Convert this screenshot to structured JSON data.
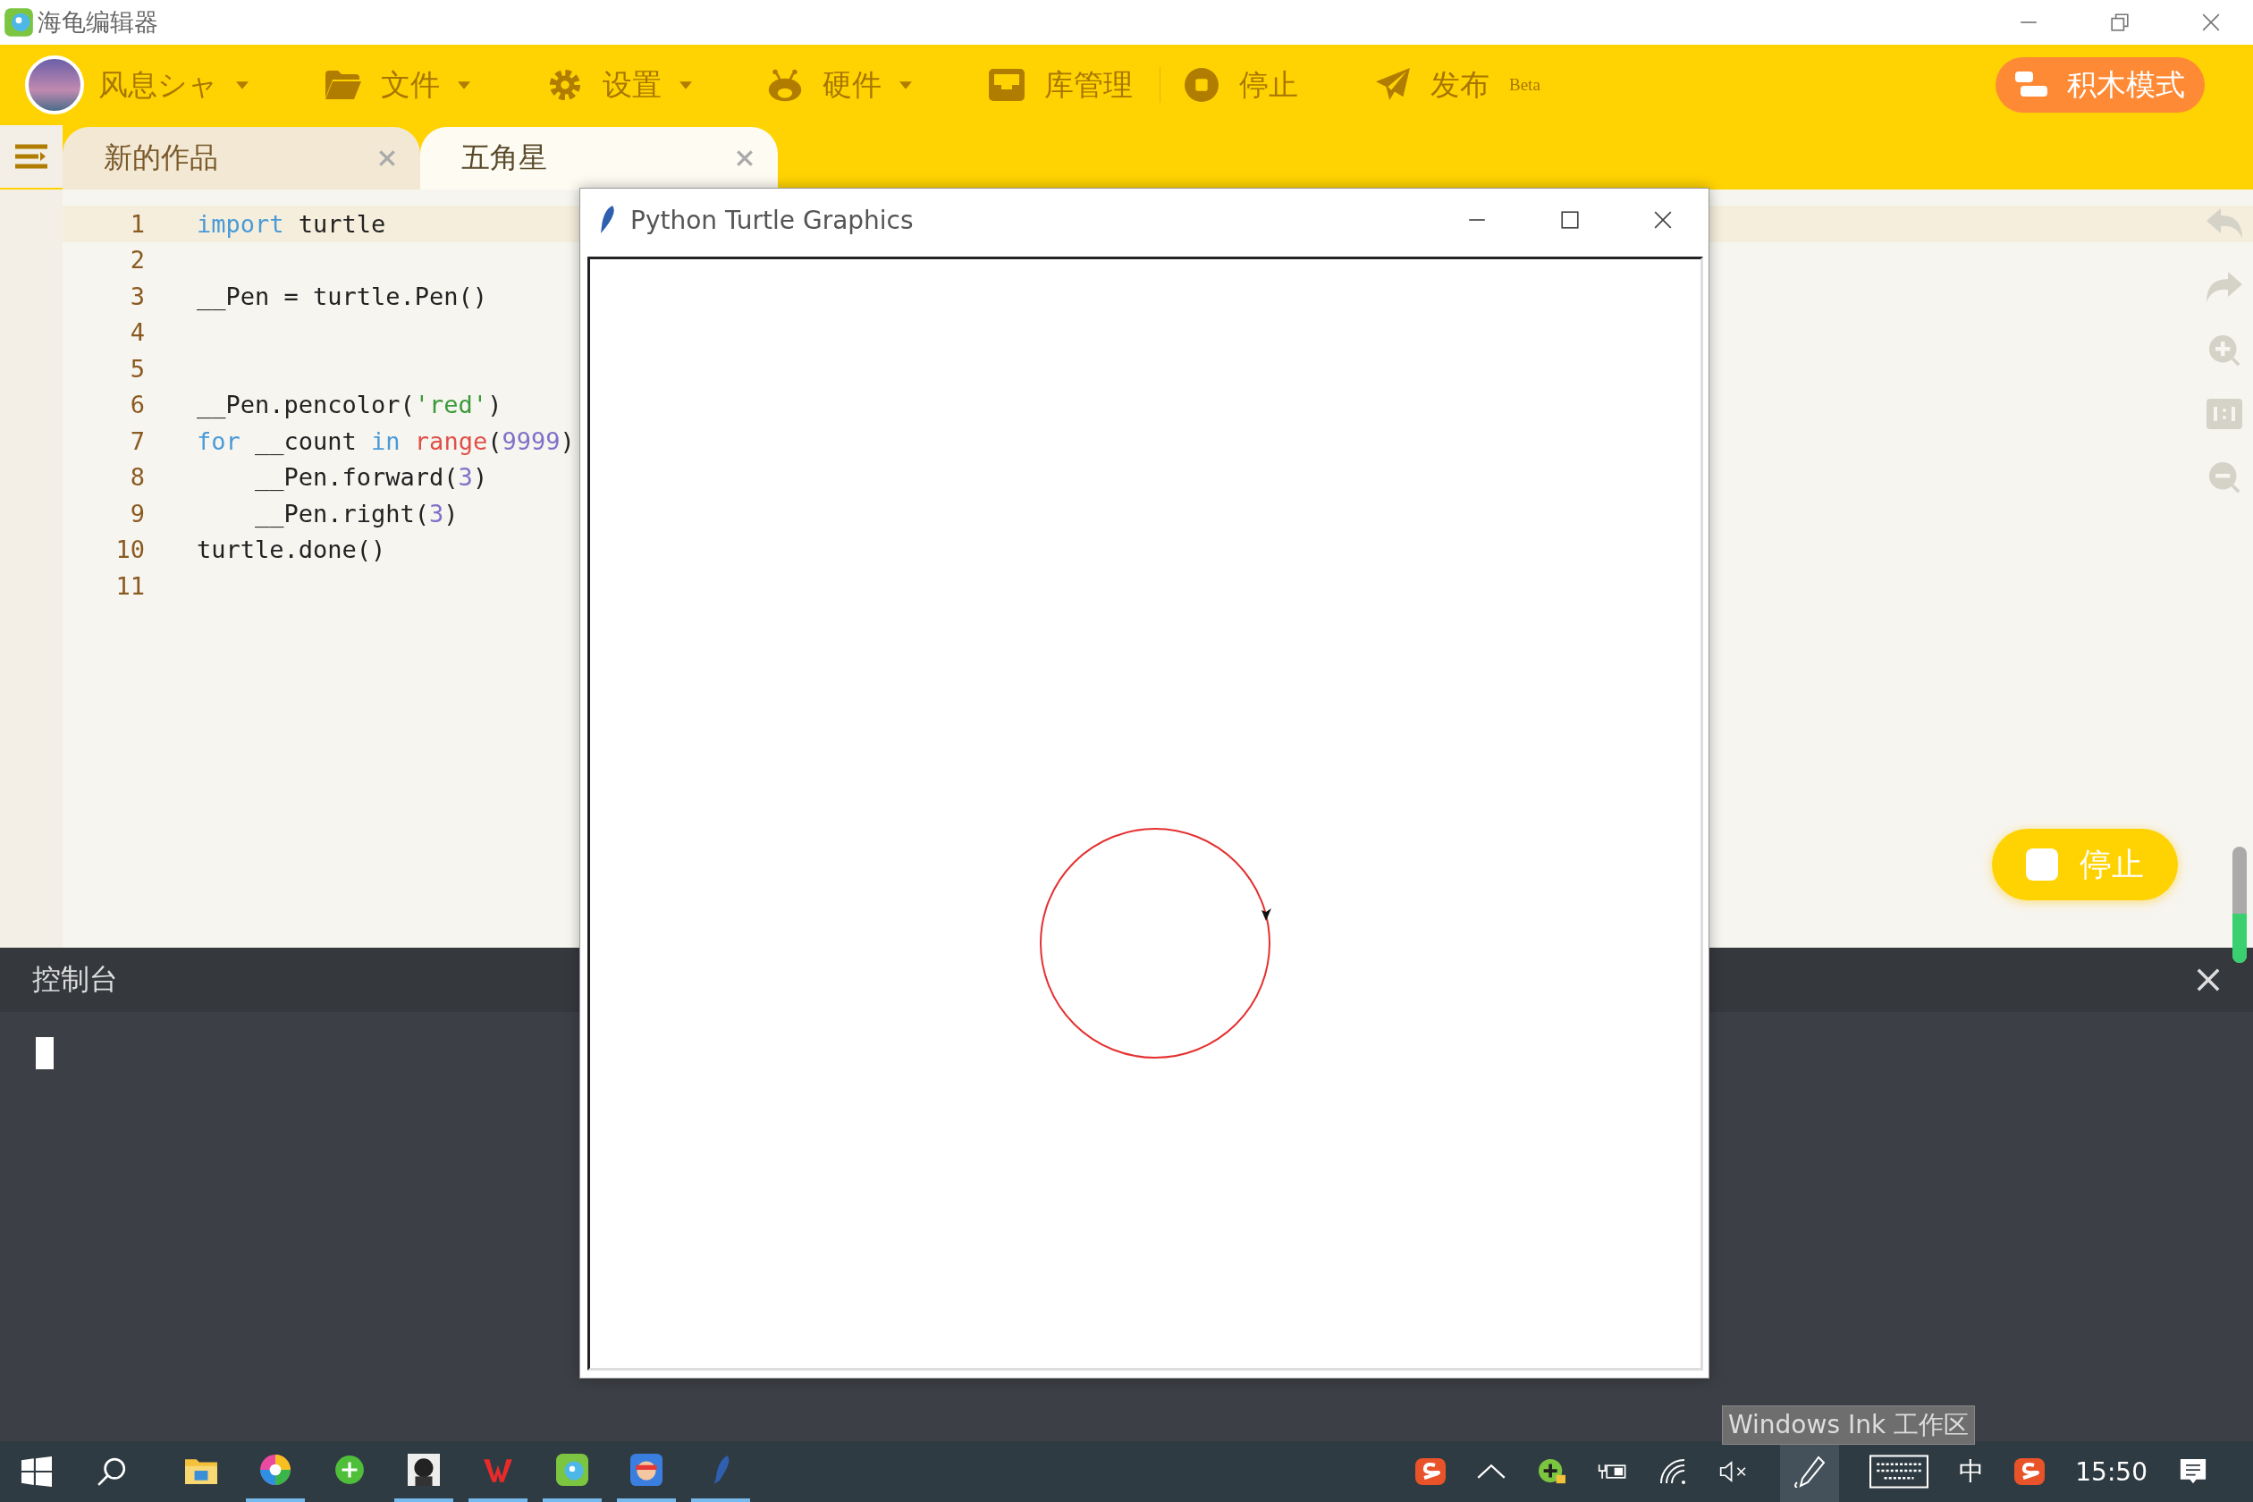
{
  "window": {
    "title": "海龟编辑器"
  },
  "toolbar": {
    "user": "风息シャ",
    "menus": [
      {
        "label": "文件",
        "kind": "folder"
      },
      {
        "label": "设置",
        "kind": "gear"
      },
      {
        "label": "硬件",
        "kind": "robot"
      }
    ],
    "buttons": [
      {
        "label": "库管理",
        "kind": "library"
      },
      {
        "label": "停止",
        "kind": "stop"
      },
      {
        "label": "发布$^{Beta}$",
        "kind": "publish"
      }
    ],
    "mode_button": "积木模式"
  },
  "tabs": [
    {
      "label": "新的作品",
      "selected": false
    },
    {
      "label": "五角星",
      "selected": true
    }
  ],
  "editor": {
    "lines": [
      {
        "number": "1",
        "tokens": [
          {
            "kind": "keyword",
            "text": "import"
          },
          {
            "kind": "plain",
            "text": " turtle"
          }
        ]
      },
      {
        "number": "2"
      },
      {
        "number": "3",
        "tokens": [
          {
            "kind": "plain",
            "text": "__Pen = turtle.Pen()"
          }
        ]
      },
      {
        "number": "4"
      },
      {
        "number": "5"
      },
      {
        "number": "6",
        "tokens": [
          {
            "kind": "plain",
            "text": "__Pen.pencolor("
          },
          {
            "kind": "string",
            "text": "'red'"
          },
          {
            "kind": "plain",
            "text": ")"
          }
        ]
      },
      {
        "number": "7",
        "tokens": [
          {
            "kind": "keyword",
            "text": "for"
          },
          {
            "kind": "plain",
            "text": " __count "
          },
          {
            "kind": "keyword",
            "text": "in"
          },
          {
            "kind": "builtin",
            "text": " range"
          },
          {
            "kind": "plain",
            "text": "("
          },
          {
            "kind": "number",
            "text": "9999"
          },
          {
            "kind": "plain",
            "text": ")"
          }
        ]
      },
      {
        "number": "8",
        "tokens": [
          {
            "kind": "plain",
            "text": "    __Pen.forward("
          },
          {
            "kind": "number",
            "text": "3"
          },
          {
            "kind": "plain",
            "text": ")"
          }
        ]
      },
      {
        "number": "9",
        "tokens": [
          {
            "kind": "plain",
            "text": "    __Pen.right("
          },
          {
            "kind": "number",
            "text": "3"
          },
          {
            "kind": "plain",
            "text": ")"
          }
        ]
      },
      {
        "number": "10",
        "tokens": [
          {
            "kind": "plain",
            "text": "turtle.done()"
          }
        ]
      },
      {
        "number": "11"
      }
    ]
  },
  "stop_button": "停止",
  "volume_meter": {
    "level": 0.42
  },
  "console": {
    "title": "控制台"
  },
  "turtle_window": {
    "title": "Python Turtle Graphics"
  },
  "tooltip": "Windows Ink 工作区",
  "taskbar": {
    "apps": [
      {
        "running": false
      },
      {
        "running": true
      },
      {
        "running": false
      },
      {
        "running": true
      },
      {
        "running": true
      },
      {
        "running": true
      },
      {
        "running": true
      },
      {
        "running": true
      }
    ],
    "ime": "中",
    "clock": "15:50"
  }
}
